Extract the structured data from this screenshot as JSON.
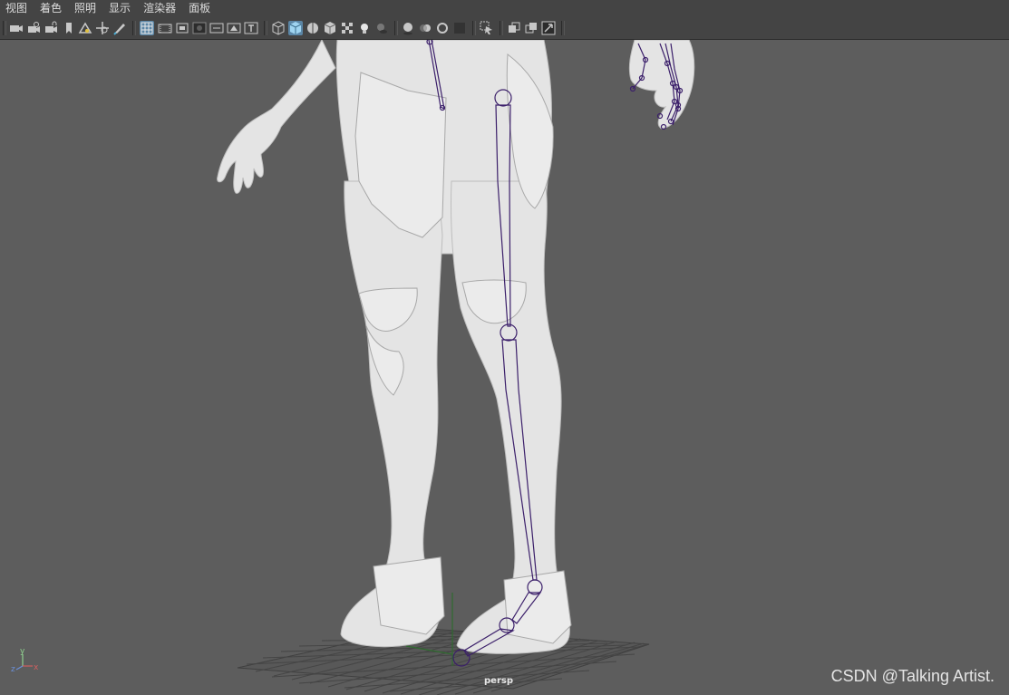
{
  "menubar": {
    "items": [
      {
        "label": "视图"
      },
      {
        "label": "着色"
      },
      {
        "label": "照明"
      },
      {
        "label": "显示"
      },
      {
        "label": "渲染器"
      },
      {
        "label": "面板"
      }
    ]
  },
  "toolbar": {
    "icons": [
      "select-camera-icon",
      "camera-attributes-icon",
      "camera-lock-icon",
      "bookmark-icon",
      "image-plane-icon",
      "2d-pan-zoom-icon",
      "grease-pencil-icon",
      "grid-icon",
      "film-gate-icon",
      "resolution-gate-icon",
      "gate-mask-icon",
      "field-chart-icon",
      "safe-action-icon",
      "safe-title-icon",
      "wireframe-icon",
      "smooth-shade-icon",
      "wireframe-on-shaded-icon",
      "default-material-icon",
      "textured-icon",
      "lights-icon",
      "shadows-icon",
      "screen-space-ao-icon",
      "motion-blur-icon",
      "anti-aliasing-icon",
      "depth-of-field-icon",
      "isolate-select-icon",
      "xray-icon",
      "xray-joints-icon",
      "xray-active-components-icon"
    ],
    "active_icons": [
      "grid-icon",
      "smooth-shade-icon"
    ]
  },
  "viewport": {
    "camera_label": "persp",
    "axis_labels": {
      "x": "x",
      "y": "y",
      "z": "z"
    },
    "colors": {
      "background": "#5d5d5d",
      "model": "#e6e6e6",
      "joint": "#3b1f6a",
      "grid": "#3f3f3f"
    }
  },
  "watermark": "CSDN @Talking Artist."
}
